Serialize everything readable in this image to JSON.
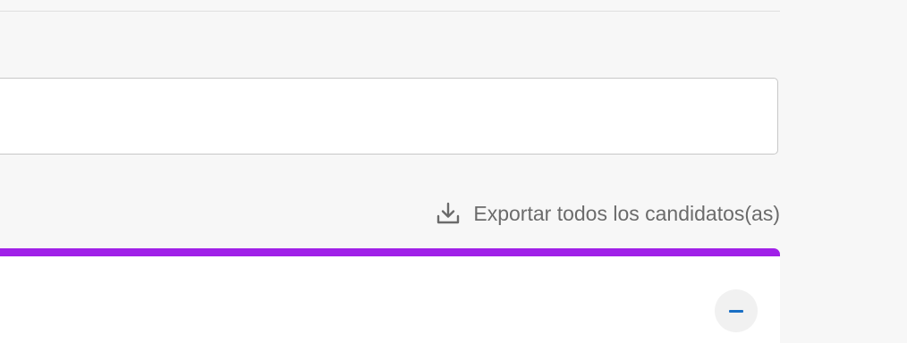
{
  "search": {
    "value": "",
    "placeholder": ""
  },
  "export": {
    "label": "Exportar todos los candidatos(as)",
    "icon": "download-icon"
  },
  "card": {
    "accent_color": "#a020e8",
    "collapse_icon": "minus-icon"
  },
  "colors": {
    "link_text": "#6b6b6b",
    "collapse_icon": "#1a6fc4",
    "background": "#f7f7f7"
  }
}
